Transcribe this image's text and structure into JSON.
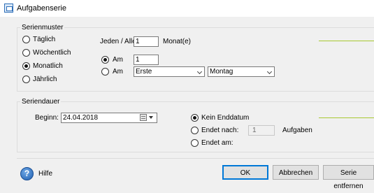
{
  "window": {
    "title": "Aufgabenserie"
  },
  "pattern": {
    "legend": "Serienmuster",
    "frequency": [
      {
        "label": "Täglich",
        "checked": false
      },
      {
        "label": "Wöchentlich",
        "checked": false
      },
      {
        "label": "Monatlich",
        "checked": true
      },
      {
        "label": "Jährlich",
        "checked": false
      }
    ],
    "interval_prefix": "Jeden / Alle",
    "interval_value": "1",
    "interval_suffix": "Monat(e)",
    "am_label": "Am",
    "am_day_value": "1",
    "am_day_checked": true,
    "am2_label": "Am",
    "am2_checked": false,
    "ordinal_value": "Erste",
    "weekday_value": "Montag"
  },
  "duration": {
    "legend": "Seriendauer",
    "begin_label": "Beginn:",
    "begin_value": "24.04.2018",
    "end_options": [
      {
        "label": "Kein Enddatum",
        "checked": true
      },
      {
        "label": "Endet nach:",
        "checked": false
      },
      {
        "label": "Endet am:",
        "checked": false
      }
    ],
    "occurrences_value": "1",
    "occurrences_suffix": "Aufgaben"
  },
  "footer": {
    "help_label": "Hilfe",
    "help_icon_glyph": "?",
    "ok_label": "OK",
    "cancel_label": "Abbrechen",
    "remove_label": "Serie entfernen"
  },
  "colors": {
    "accent_line": "#a8c832",
    "default_button_border": "#0078d7"
  }
}
